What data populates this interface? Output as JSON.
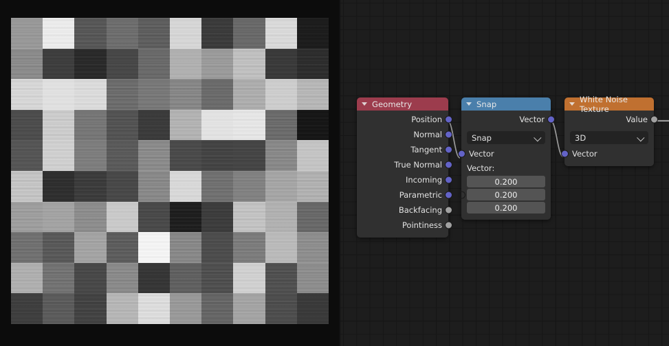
{
  "app": {
    "editor": "shader-node-editor",
    "background_color": "#1d1d1d",
    "grid_color": "#161616"
  },
  "preview": {
    "name": "white-noise-texture-preview",
    "description": "Blocky grayscale white-noise texture render",
    "grid": {
      "cols": 10,
      "rows": 10
    },
    "cells": [
      [
        "#9a9a9a",
        "#eeeeee",
        "#585858",
        "#6f6f6f",
        "#5f5f5f",
        "#d8d8d8",
        "#3b3b3b",
        "#6a6a6a",
        "#dcdcdc",
        "#1c1c1c"
      ],
      [
        "#8d8d8d",
        "#3e3e3e",
        "#2a2a2a",
        "#484848",
        "#6b6b6b",
        "#b2b2b2",
        "#9d9d9d",
        "#c3c3c3",
        "#3a3a3a",
        "#2d2d2d"
      ],
      [
        "#d9d9d9",
        "#e2e2e2",
        "#dedede",
        "#6e6e6e",
        "#7a7a7a",
        "#898989",
        "#6c6c6c",
        "#b0b0b0",
        "#cfcfcf",
        "#b9b9b9"
      ],
      [
        "#4d4d4d",
        "#cfcfcf",
        "#787878",
        "#545454",
        "#3b3b3b",
        "#b5b5b5",
        "#e4e4e4",
        "#e9e9e9",
        "#6d6d6d",
        "#161616"
      ],
      [
        "#565656",
        "#d3d3d3",
        "#7f7f7f",
        "#5b5b5b",
        "#8d8d8d",
        "#4b4b4b",
        "#444444",
        "#464646",
        "#8b8b8b",
        "#c6c6c6"
      ],
      [
        "#c8c8c8",
        "#2f2f2f",
        "#3c3c3c",
        "#494949",
        "#8b8b8b",
        "#dadada",
        "#727272",
        "#838383",
        "#a8a8a8",
        "#b4b4b4"
      ],
      [
        "#a0a0a0",
        "#a5a5a5",
        "#8f8f8f",
        "#cbcbcb",
        "#4a4a4a",
        "#1e1e1e",
        "#3d3d3d",
        "#c6c6c6",
        "#b3b3b3",
        "#6a6a6a"
      ],
      [
        "#727272",
        "#5a5a5a",
        "#a6a6a6",
        "#5e5e5e",
        "#f6f6f6",
        "#8a8a8a",
        "#4d4d4d",
        "#7e7e7e",
        "#bcbcbc",
        "#909090"
      ],
      [
        "#b1b1b1",
        "#747474",
        "#494949",
        "#8c8c8c",
        "#363636",
        "#616161",
        "#505050",
        "#d3d3d3",
        "#515151",
        "#8f8f8f"
      ],
      [
        "#3f3f3f",
        "#5c5c5c",
        "#434343",
        "#b8b8b8",
        "#e0e0e0",
        "#9b9b9b",
        "#676767",
        "#a6a6a6",
        "#4e4e4e",
        "#3a3a3a"
      ]
    ]
  },
  "nodes": [
    {
      "id": "geometry",
      "title": "Geometry",
      "header_color": "#9c3c4d",
      "collapse_icon": "triangle-down-icon",
      "outputs": [
        {
          "label": "Position",
          "socket_type": "vector",
          "socket_color": "#6363c7"
        },
        {
          "label": "Normal",
          "socket_type": "vector",
          "socket_color": "#6363c7"
        },
        {
          "label": "Tangent",
          "socket_type": "vector",
          "socket_color": "#6363c7"
        },
        {
          "label": "True Normal",
          "socket_type": "vector",
          "socket_color": "#6363c7"
        },
        {
          "label": "Incoming",
          "socket_type": "vector",
          "socket_color": "#6363c7"
        },
        {
          "label": "Parametric",
          "socket_type": "vector",
          "socket_color": "#6363c7"
        },
        {
          "label": "Backfacing",
          "socket_type": "value",
          "socket_color": "#a1a1a1"
        },
        {
          "label": "Pointiness",
          "socket_type": "value",
          "socket_color": "#a1a1a1"
        }
      ]
    },
    {
      "id": "snap",
      "title": "Snap",
      "header_color": "#4a7fab",
      "collapse_icon": "triangle-down-icon",
      "outputs": [
        {
          "label": "Vector",
          "socket_type": "vector",
          "socket_color": "#6363c7"
        }
      ],
      "operation_dropdown": {
        "value": "Snap",
        "icon": "chevron-down-icon"
      },
      "inputs": [
        {
          "label": "Vector",
          "socket_type": "vector",
          "socket_color": "#6363c7"
        }
      ],
      "vector_property": {
        "label": "Vector:",
        "values": [
          "0.200",
          "0.200",
          "0.200"
        ]
      }
    },
    {
      "id": "white-noise-texture",
      "title": "White Noise Texture",
      "header_color": "#c07030",
      "collapse_icon": "triangle-down-icon",
      "outputs": [
        {
          "label": "Value",
          "socket_type": "value",
          "socket_color": "#a1a1a1"
        }
      ],
      "dimension_dropdown": {
        "value": "3D",
        "icon": "chevron-down-icon"
      },
      "inputs": [
        {
          "label": "Vector",
          "socket_type": "vector",
          "socket_color": "#6363c7"
        }
      ]
    }
  ],
  "links": [
    {
      "from": "geometry.Position",
      "to": "snap.Vector",
      "color": "#9b9b9b"
    },
    {
      "from": "snap.Vector",
      "to": "white-noise-texture.Vector",
      "color": "#9b9b9b"
    },
    {
      "from": "white-noise-texture.Value",
      "to": "offscreen",
      "color": "#9b9b9b"
    }
  ]
}
